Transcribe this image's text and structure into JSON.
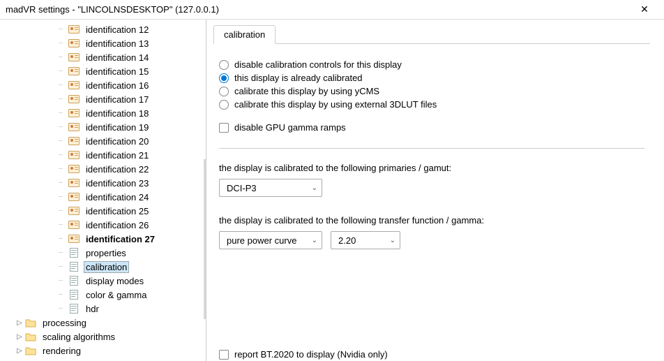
{
  "window": {
    "title": "madVR settings - \"LINCOLNSDESKTOP\" (127.0.0.1)",
    "close_glyph": "✕"
  },
  "tree": {
    "identifications": [
      "identification 12",
      "identification 13",
      "identification 14",
      "identification 15",
      "identification 16",
      "identification 17",
      "identification 18",
      "identification 19",
      "identification 20",
      "identification 21",
      "identification 22",
      "identification 23",
      "identification 24",
      "identification 25",
      "identification 26",
      "identification 27"
    ],
    "settings": [
      {
        "label": "properties"
      },
      {
        "label": "calibration",
        "selected": true
      },
      {
        "label": "display modes"
      },
      {
        "label": "color & gamma"
      },
      {
        "label": "hdr"
      }
    ],
    "roots": [
      "processing",
      "scaling algorithms",
      "rendering"
    ]
  },
  "content": {
    "tab": "calibration",
    "radios": [
      {
        "label": "disable calibration controls for this display",
        "checked": false
      },
      {
        "label": "this display is already calibrated",
        "checked": true
      },
      {
        "label": "calibrate this display by using yCMS",
        "checked": false
      },
      {
        "label": "calibrate this display by using external 3DLUT files",
        "checked": false
      }
    ],
    "checkbox_gpu": "disable GPU gamma ramps",
    "primaries_label": "the display is calibrated to the following primaries / gamut:",
    "primaries_value": "DCI-P3",
    "transfer_label": "the display is calibrated to the following transfer function / gamma:",
    "transfer_value": "pure power curve",
    "gamma_value": "2.20",
    "report_bt2020": "report BT.2020 to display  (Nvidia only)"
  }
}
